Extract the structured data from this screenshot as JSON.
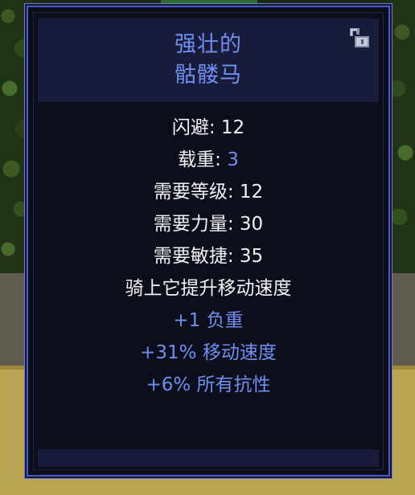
{
  "item": {
    "title_line1": "强壮的",
    "title_line2": "骷髅马",
    "lock_icon": "unlocked-padlock-icon"
  },
  "stats": [
    {
      "label": "闪避: ",
      "value": "12",
      "value_color": "white"
    },
    {
      "label": "载重: ",
      "value": "3",
      "value_color": "blue"
    },
    {
      "label": "需要等级: ",
      "value": "12",
      "value_color": "white"
    },
    {
      "label": "需要力量: ",
      "value": "30",
      "value_color": "white"
    },
    {
      "label": "需要敏捷: ",
      "value": "35",
      "value_color": "white"
    }
  ],
  "description": "骑上它提升移动速度",
  "modifiers": [
    "+1 负重",
    "+31% 移动速度",
    "+6% 所有抗性"
  ],
  "colors": {
    "accent_blue": "#6f8ff0",
    "panel_bg": "#0c0e1c",
    "header_bg": "#181c3a",
    "border": "#4a5cc4",
    "text_white": "#f2f2f2"
  }
}
